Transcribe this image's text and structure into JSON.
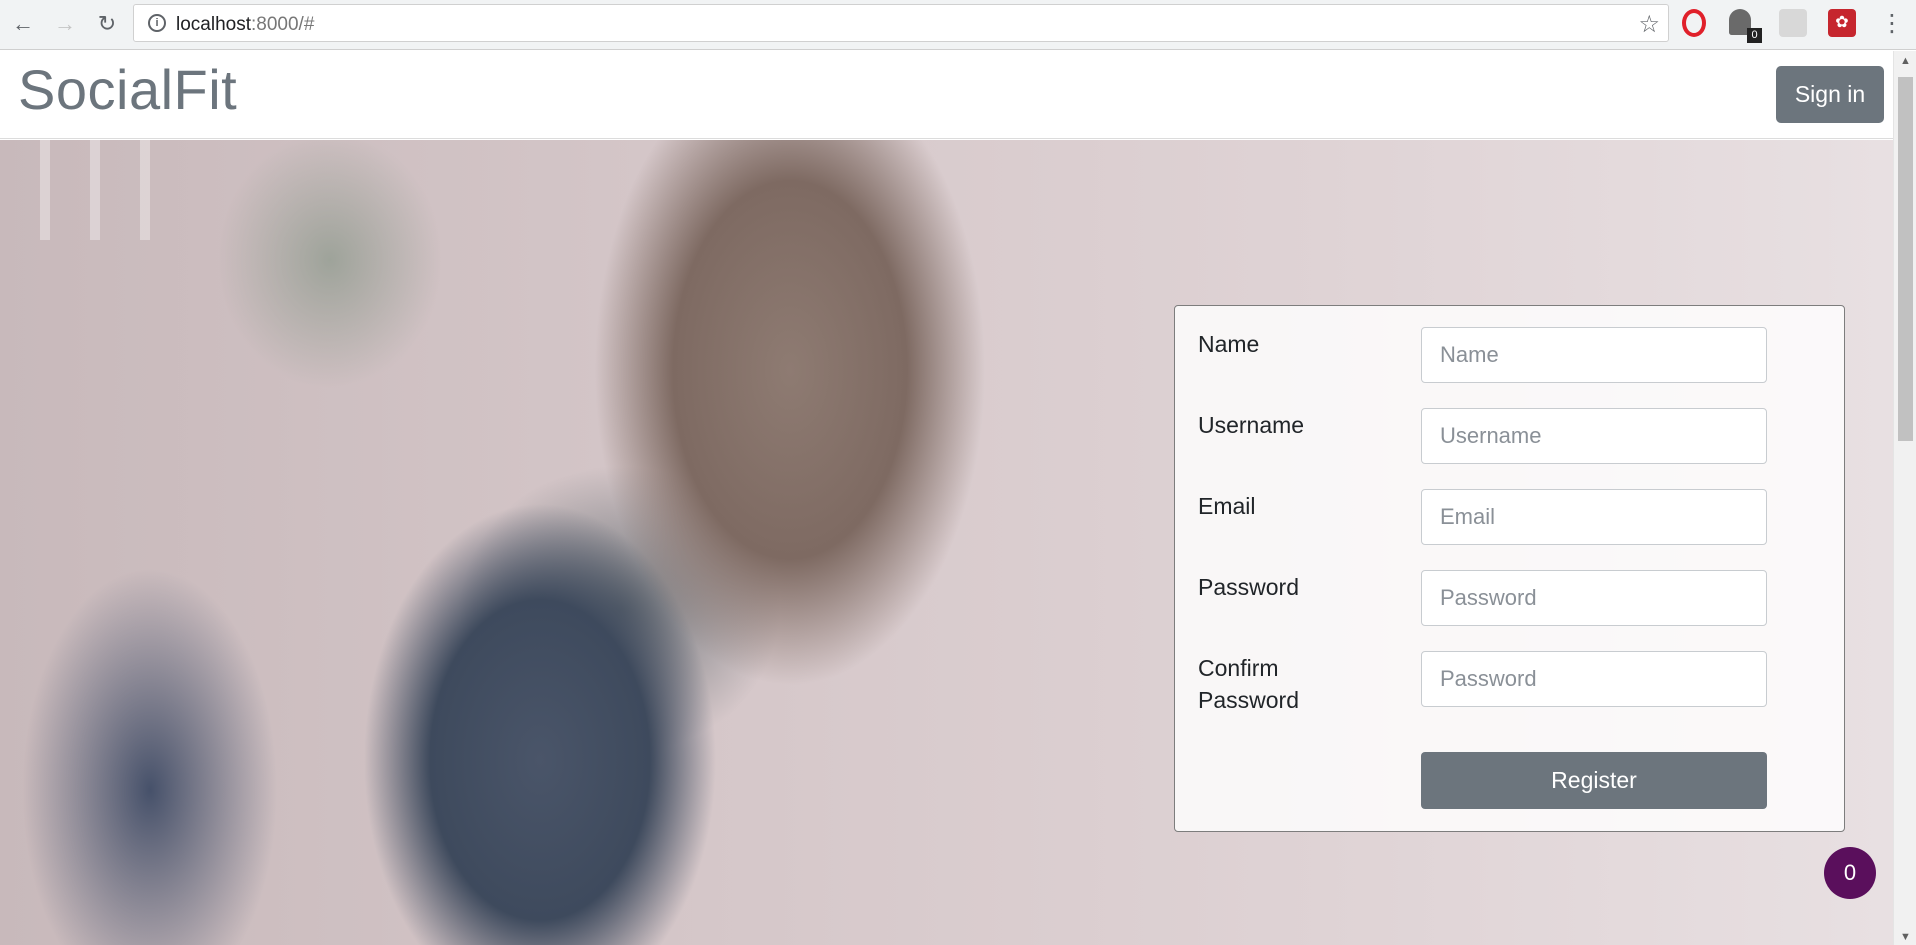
{
  "browser": {
    "back_glyph": "←",
    "forward_glyph": "→",
    "reload_glyph": "↻",
    "url_host": "localhost",
    "url_rest": ":8000/#",
    "star_glyph": "☆",
    "extension_badge": "0",
    "menu_glyph": "⋮"
  },
  "navbar": {
    "brand": "SocialFit",
    "signin_label": "Sign in"
  },
  "form": {
    "fields": [
      {
        "label": "Name",
        "placeholder": "Name"
      },
      {
        "label": "Username",
        "placeholder": "Username"
      },
      {
        "label": "Email",
        "placeholder": "Email"
      },
      {
        "label": "Password",
        "placeholder": "Password"
      },
      {
        "label_line1": "Confirm",
        "label_line2": "Password",
        "placeholder": "Password"
      }
    ],
    "register_label": "Register"
  },
  "floating_badge": "0",
  "colors": {
    "button_gray": "#6c757d",
    "badge_purple": "#5a0f5c"
  }
}
